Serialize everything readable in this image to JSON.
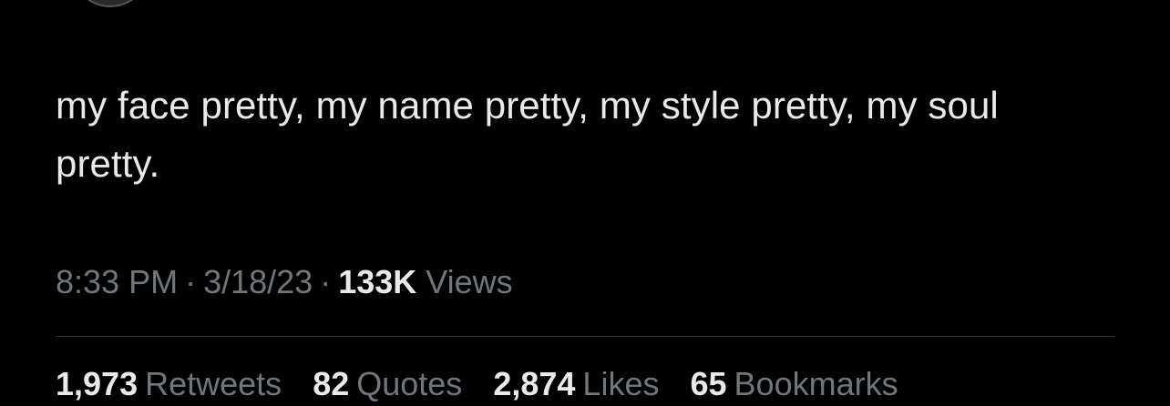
{
  "tweet": {
    "text": "my face pretty, my name pretty, my style pretty, my soul pretty."
  },
  "meta": {
    "time": "8:33 PM",
    "separator": "·",
    "date": "3/18/23",
    "views_count": "133K",
    "views_label": "Views"
  },
  "stats": [
    {
      "count": "1,973",
      "label": "Retweets"
    },
    {
      "count": "82",
      "label": "Quotes"
    },
    {
      "count": "2,874",
      "label": "Likes"
    },
    {
      "count": "65",
      "label": "Bookmarks"
    }
  ],
  "colors": {
    "background": "#000000",
    "primary_text": "#e7e9ea",
    "secondary_text": "#71767b",
    "divider": "#2f3336"
  }
}
